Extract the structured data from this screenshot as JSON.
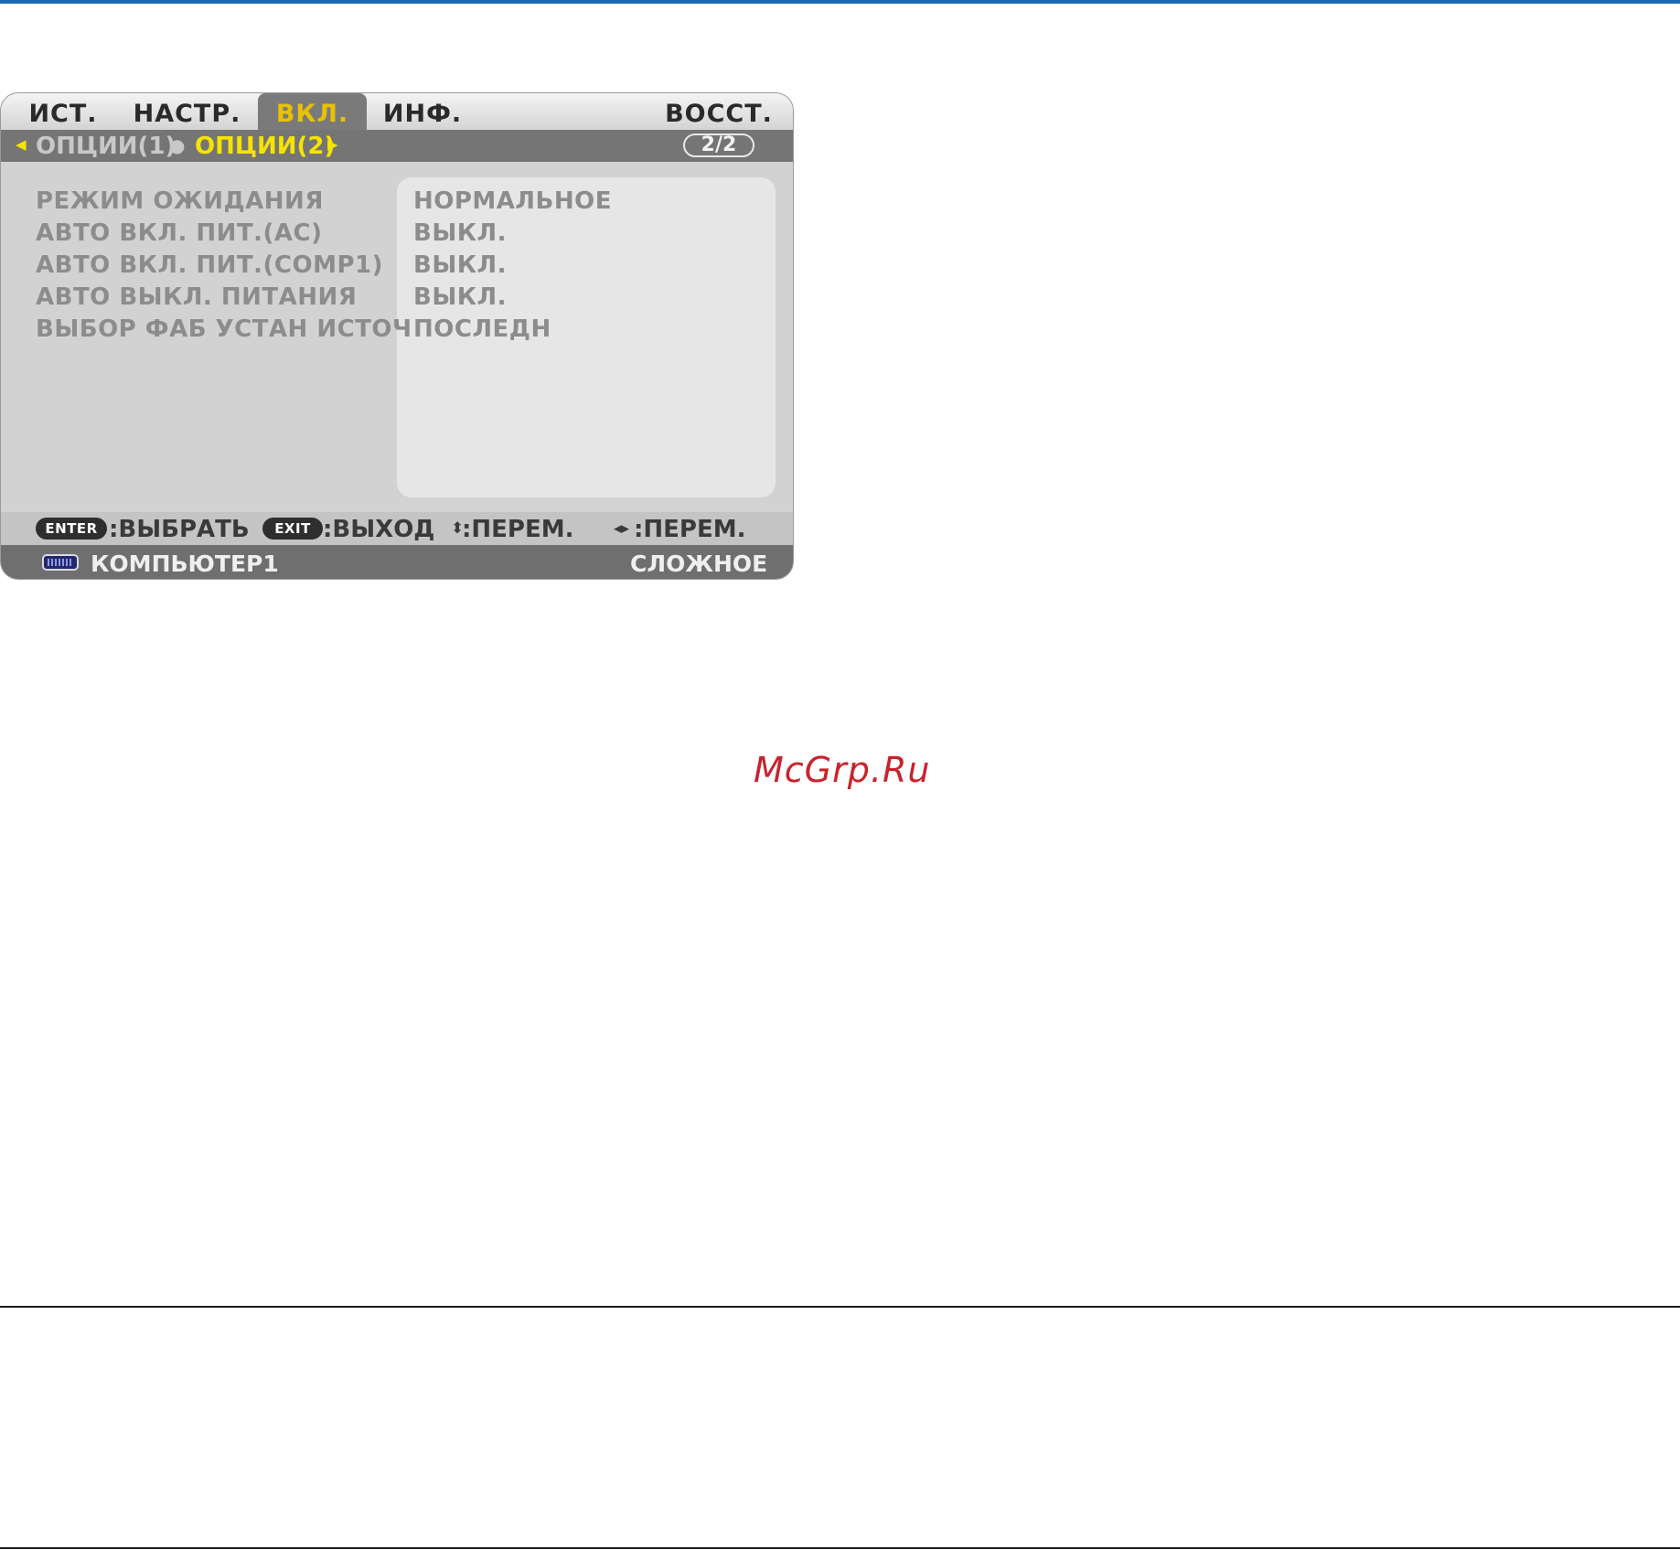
{
  "tabs": [
    {
      "label": "ИСТ.",
      "active": false
    },
    {
      "label": "НАСТР.",
      "active": false
    },
    {
      "label": "ВКЛ.",
      "active": true
    },
    {
      "label": "ИНФ.",
      "active": false
    },
    {
      "label": "ВОССТ.",
      "active": false
    }
  ],
  "subtabs": [
    {
      "label": "ОПЦИИ(1)",
      "active": false
    },
    {
      "label": "ОПЦИИ(2)",
      "active": true
    }
  ],
  "page_indicator": "2/2",
  "settings": [
    {
      "label": "РЕЖИМ ОЖИДАНИЯ",
      "value": "НОРМАЛЬНОЕ"
    },
    {
      "label": "АВТО ВКЛ. ПИТ.(AC)",
      "value": "ВЫКЛ."
    },
    {
      "label": "АВТО ВКЛ. ПИТ.(COMP1)",
      "value": "ВЫКЛ."
    },
    {
      "label": "АВТО ВЫКЛ. ПИТАНИЯ",
      "value": "ВЫКЛ."
    },
    {
      "label": "ВЫБОР ФАБ УСТАН ИСТОЧ",
      "value": "ПОСЛЕДН"
    }
  ],
  "hints": {
    "enter_key": "ENTER",
    "enter_text": ":ВЫБРАТЬ",
    "exit_key": "EXIT",
    "exit_text": ":ВЫХОД",
    "updown_text": ":ПЕРЕМ.",
    "leftright_text": ":ПЕРЕМ."
  },
  "status": {
    "source_icon": "computer-port-icon",
    "source": "КОМПЬЮТЕР1",
    "mode": "СЛОЖНОЕ"
  },
  "watermark": "McGrp.Ru",
  "colors": {
    "active_tab_text": "#e8c100",
    "active_subtab_text": "#f5e400",
    "inactive_subtab_text": "#c8c8c8",
    "accent_rule": "#1a68b4",
    "watermark": "#c8232b"
  }
}
